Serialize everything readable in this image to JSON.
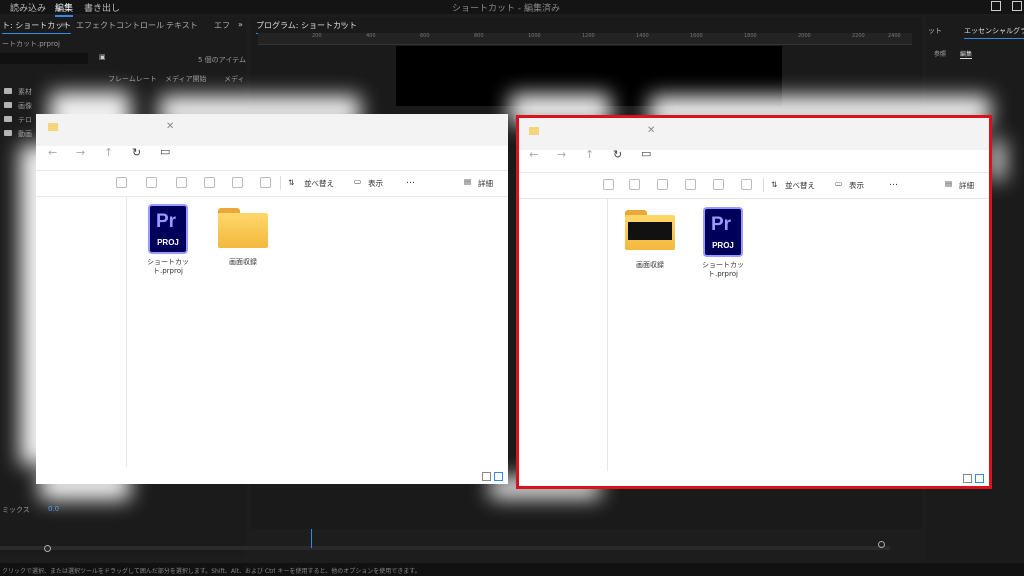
{
  "topbar": {
    "nav": [
      "読み込み",
      "編集",
      "書き出し"
    ],
    "active_index": 1,
    "title": "ショートカット - 編集済み"
  },
  "project_panel": {
    "tabs": [
      "ト: ショートカット",
      "エフェクトコントロール",
      "テキスト",
      "エフ"
    ],
    "path": "ートカット.prproj",
    "item_count": "5 個のアイテム",
    "columns": [
      "フレームレート",
      "メディア開始",
      "メディ"
    ],
    "items": [
      "素材",
      "画像",
      "テロ",
      "動画"
    ],
    "mix_label": "ミックス",
    "mix_value": "0.0"
  },
  "program_monitor": {
    "title": "プログラム: ショートカット",
    "ruler_ticks": [
      "200",
      "400",
      "600",
      "800",
      "1000",
      "1200",
      "1400",
      "1600",
      "1800",
      "2000",
      "2200",
      "2400"
    ]
  },
  "right_panel": {
    "tabs": [
      "ット",
      "エッセンシャルグラフ"
    ],
    "subtabs": [
      "参照",
      "編集"
    ]
  },
  "explorer_left": {
    "toolbar": {
      "sort": "並べ替え",
      "view": "表示",
      "more": "…",
      "details": "詳細"
    },
    "files": [
      {
        "name": "ショートカット.prproj",
        "kind": "premiere-project"
      },
      {
        "name": "画面収録",
        "kind": "folder"
      }
    ],
    "pr_badge": "Pr",
    "proj_badge": "PROJ"
  },
  "explorer_right": {
    "toolbar": {
      "sort": "並べ替え",
      "view": "表示",
      "more": "…",
      "details": "詳細"
    },
    "files": [
      {
        "name": "画面収録",
        "kind": "folder-with-preview"
      },
      {
        "name": "ショートカット.prproj",
        "kind": "premiere-project"
      }
    ],
    "pr_badge": "Pr",
    "proj_badge": "PROJ"
  },
  "status_bar": "クリックで選択、または選択ツールをドラッグして囲んだ部分を選択します。Shift、Alt、および Ctrl キーを使用すると、他のオプションを使用できます。",
  "colors": {
    "highlight": "#d9121e",
    "premiere": "#00005b",
    "premiere_text": "#9999ff",
    "accent": "#2d8ceb"
  }
}
